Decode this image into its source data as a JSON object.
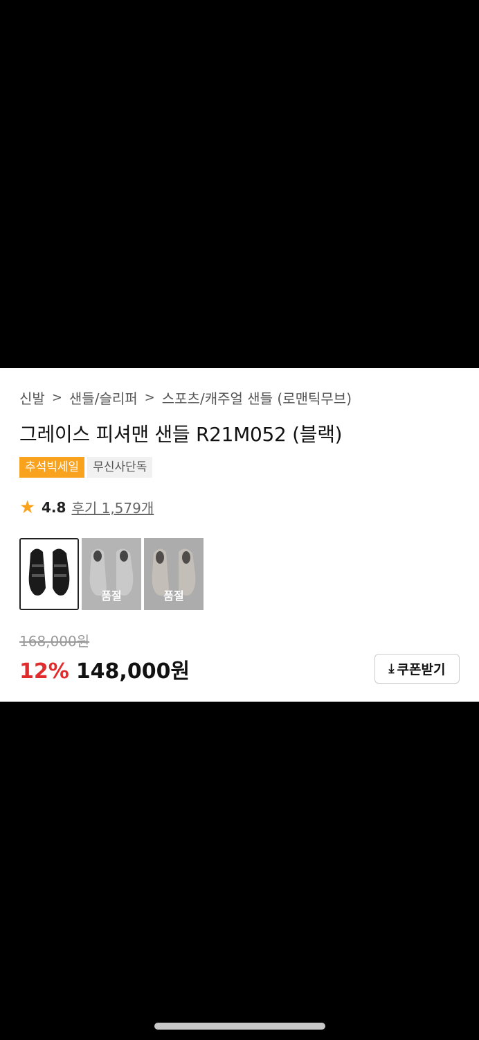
{
  "breadcrumb": {
    "items": [
      "신발",
      "샌들/슬리퍼",
      "스포츠/캐주얼 샌들 (로맨틱무브)"
    ],
    "separator": ">"
  },
  "product": {
    "title": "그레이스 피셔맨 샌들 R21M052 (블랙)",
    "badges": {
      "sale": "추석빅세일",
      "exclusive": "무신사단독"
    },
    "rating": {
      "icon": "star-icon",
      "score": "4.8",
      "reviews": "후기 1,579개"
    },
    "thumbnails": [
      {
        "color": "black",
        "soldout": false,
        "label": ""
      },
      {
        "color": "white",
        "soldout": true,
        "label": "품절"
      },
      {
        "color": "beige",
        "soldout": true,
        "label": "품절"
      }
    ],
    "price": {
      "original": "168,000원",
      "discount": "12%",
      "sale": "148,000원"
    },
    "coupon": {
      "icon": "download-icon",
      "label": "쿠폰받기"
    }
  },
  "colors": {
    "accent_orange": "#f8a21d",
    "discount_red": "#e02c2c"
  }
}
